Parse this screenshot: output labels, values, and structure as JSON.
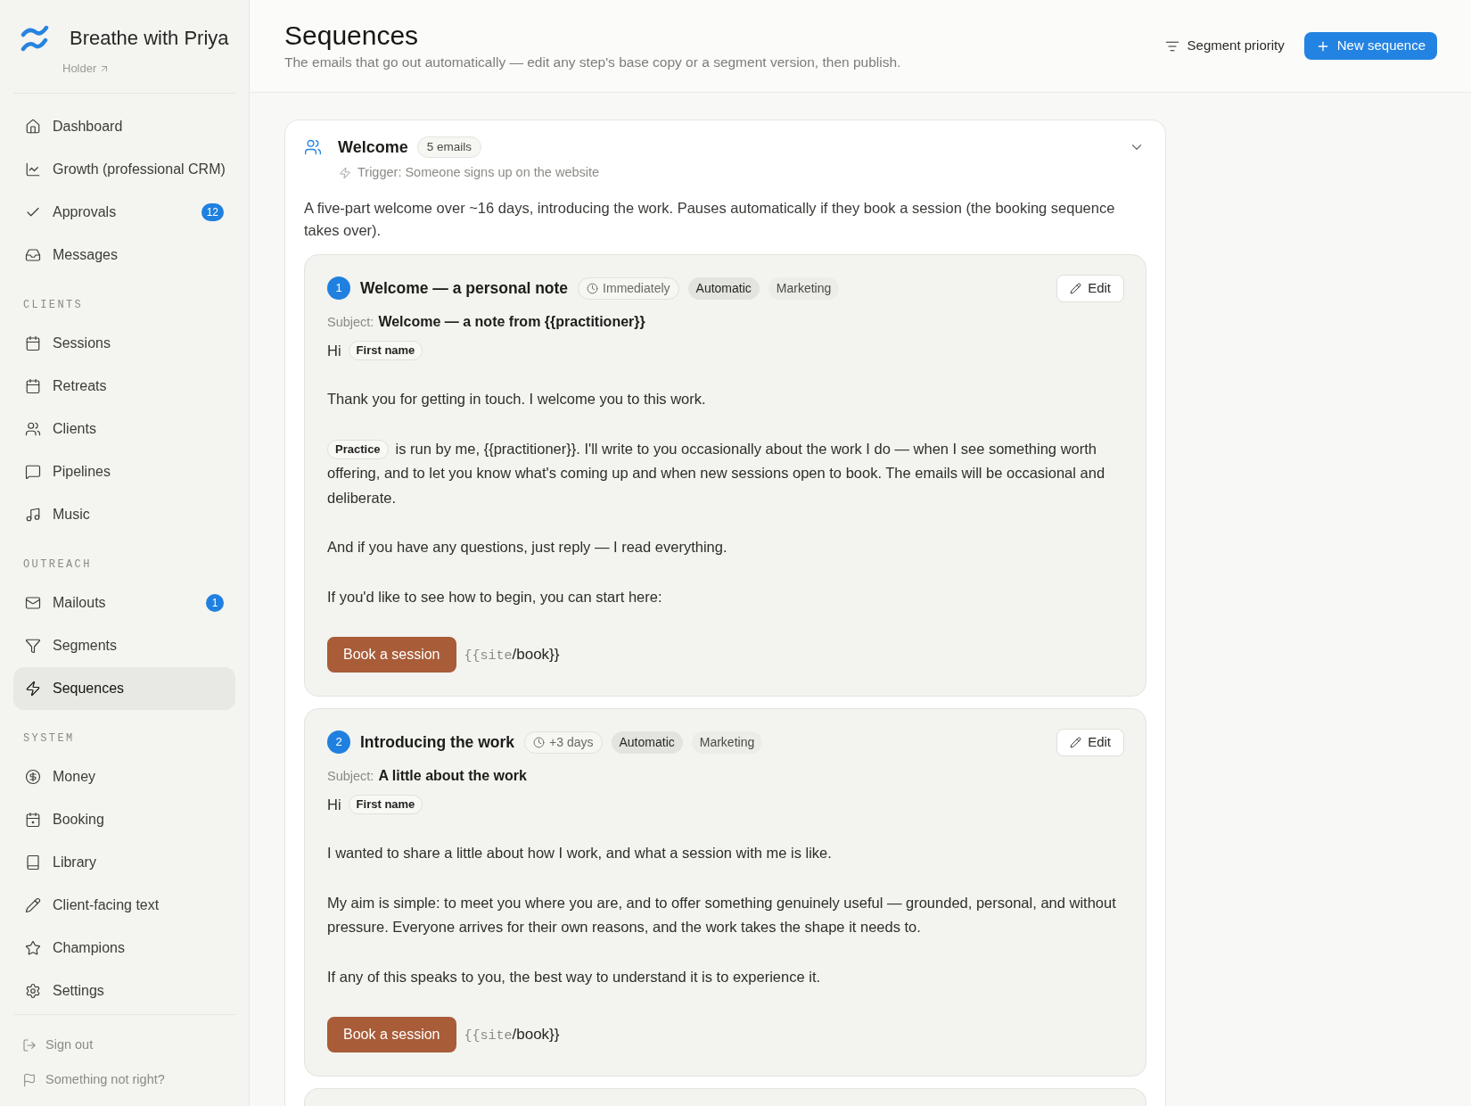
{
  "sidebar": {
    "brand": {
      "name": "Breathe with Priya",
      "link": "Holder"
    },
    "sections": [
      {
        "items": [
          {
            "label": "Dashboard",
            "selected": false
          },
          {
            "label": "Growth (professional CRM)",
            "selected": false
          },
          {
            "label": "Approvals",
            "selected": false,
            "badge": "12"
          },
          {
            "label": "Messages",
            "selected": false
          }
        ]
      },
      {
        "heading": "CLIENTS",
        "items": [
          {
            "label": "Sessions",
            "selected": false
          },
          {
            "label": "Retreats",
            "selected": false
          },
          {
            "label": "Clients",
            "selected": false
          },
          {
            "label": "Pipelines",
            "selected": false
          },
          {
            "label": "Music",
            "selected": false
          }
        ]
      },
      {
        "heading": "OUTREACH",
        "items": [
          {
            "label": "Mailouts",
            "selected": false,
            "badge": "1"
          },
          {
            "label": "Segments",
            "selected": false
          },
          {
            "label": "Sequences",
            "selected": true
          }
        ]
      },
      {
        "heading": "SYSTEM",
        "items": [
          {
            "label": "Money",
            "selected": false
          },
          {
            "label": "Booking",
            "selected": false
          },
          {
            "label": "Library",
            "selected": false
          },
          {
            "label": "Client-facing text",
            "selected": false
          },
          {
            "label": "Champions",
            "selected": false
          },
          {
            "label": "Settings",
            "selected": false
          }
        ]
      }
    ],
    "footer_links": [
      {
        "label": "Sign out"
      },
      {
        "label": "Something not right?"
      }
    ]
  },
  "header": {
    "title": "Sequences",
    "subtitle": "The emails that go out automatically — edit any step's base copy or a segment version, then publish.",
    "actions": [
      {
        "kind": "ghost",
        "label": "Segment priority"
      },
      {
        "kind": "primary",
        "label": "New sequence"
      }
    ]
  },
  "sequences": [
    {
      "title": "Welcome",
      "count": "5 emails",
      "trigger": "Trigger: Someone signs up on the website",
      "expanded": true,
      "description": "A five-part welcome over ~16 days, introducing the work. Pauses automatically if they book a session (the booking sequence takes over).",
      "steps": [
        {
          "number": "1",
          "title": "Welcome — a personal note",
          "tags": [
            {
              "kind": "timing",
              "label": "Immediately"
            },
            {
              "kind": "mode",
              "label": "Automatic"
            },
            {
              "kind": "category",
              "label": "Marketing"
            }
          ],
          "edit": "Edit",
          "subject_label": "Subject:",
          "subject": "Welcome — a note from {{practitioner}}",
          "greeting": "Hi",
          "greeting_field": "First name",
          "paragraphs": [
            {
              "text": "Thank you for getting in touch. I welcome you to this work."
            },
            {
              "field": "Practice",
              "text": "is run by me, {{practitioner}}. I'll write to you occasionally about the work I do — when I see something worth offering, and to let you know what's coming up and when new sessions open to book. The emails will be occasional and deliberate."
            },
            {
              "text": "And if you have any questions, just reply — I read everything."
            },
            {
              "text": "If you'd like to see how to begin, you can start here:"
            }
          ],
          "cta": {
            "label": "Book a session",
            "link_variable": "{{site",
            "link_path": "/book}}"
          }
        },
        {
          "number": "2",
          "title": "Introducing the work",
          "tags": [
            {
              "kind": "timing",
              "label": "+3 days"
            },
            {
              "kind": "mode",
              "label": "Automatic"
            },
            {
              "kind": "category",
              "label": "Marketing"
            }
          ],
          "edit": "Edit",
          "subject_label": "Subject:",
          "subject": "A little about the work",
          "greeting": "Hi",
          "greeting_field": "First name",
          "paragraphs": [
            {
              "text": "I wanted to share a little about how I work, and what a session with me is like."
            },
            {
              "text": "My aim is simple: to meet you where you are, and to offer something genuinely useful — grounded, personal, and without pressure. Everyone arrives for their own reasons, and the work takes the shape it needs to."
            },
            {
              "text": "If any of this speaks to you, the best way to understand it is to experience it."
            }
          ],
          "cta": {
            "label": "Book a session",
            "link_variable": "{{site",
            "link_path": "/book}}"
          }
        }
      ]
    }
  ]
}
